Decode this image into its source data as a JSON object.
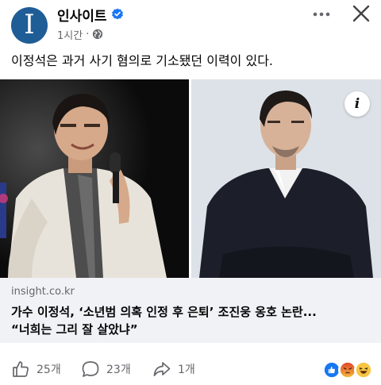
{
  "page": {
    "name": "인사이트",
    "avatar_letter": "I",
    "time": "1시간",
    "separator": "·"
  },
  "post": {
    "text": "이정석은 과거 사기 혐의로 기소됐던 이력이 있다."
  },
  "link": {
    "domain": "insight.co.kr",
    "title_line1": "가수 이정석, ‘소년범 의혹 인정 후 은퇴’ 조진웅 옹호 논란...",
    "title_line2": "“너희는 그리 잘 살았냐”"
  },
  "actions": {
    "like_count": "25개",
    "comment_count": "23개",
    "share_count": "1개"
  },
  "colors": {
    "brand": "#1f5d97",
    "verified": "#1877f2",
    "meta_text": "#65676b",
    "link_bg": "#f0f2f5"
  },
  "icons": [
    "verified-icon",
    "globe-icon",
    "more-icon",
    "close-icon",
    "info-icon",
    "like-icon",
    "comment-icon",
    "share-icon",
    "like-reaction-icon",
    "angry-reaction-icon",
    "haha-reaction-icon"
  ]
}
